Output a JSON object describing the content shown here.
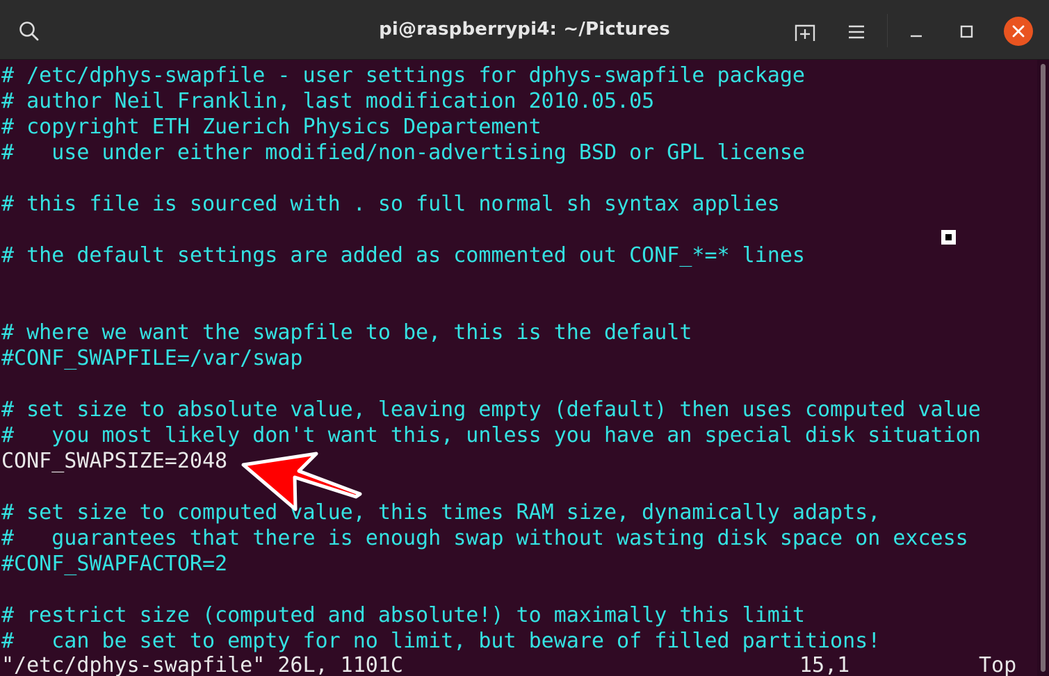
{
  "window": {
    "title": "pi@raspberrypi4: ~/Pictures",
    "icons": {
      "search": "search-icon",
      "new_tab": "new-tab-icon",
      "menu": "hamburger-menu-icon",
      "minimize": "minimize-icon",
      "maximize": "maximize-icon",
      "close": "close-icon"
    },
    "colors": {
      "terminal_bg": "#300a24",
      "comment_text": "#34e2e2",
      "plain_text": "#e8e8e8",
      "close_button": "#e95420",
      "arrow": "#ff0000"
    }
  },
  "editor": {
    "lines": [
      "# /etc/dphys-swapfile - user settings for dphys-swapfile package",
      "# author Neil Franklin, last modification 2010.05.05",
      "# copyright ETH Zuerich Physics Departement",
      "#   use under either modified/non-advertising BSD or GPL license",
      "",
      "# this file is sourced with . so full normal sh syntax applies",
      "",
      "# the default settings are added as commented out CONF_*=* lines",
      "",
      "",
      "# where we want the swapfile to be, this is the default",
      "#CONF_SWAPFILE=/var/swap",
      "",
      "# set size to absolute value, leaving empty (default) then uses computed value",
      "#   you most likely don't want this, unless you have an special disk situation",
      "CONF_SWAPSIZE=2048",
      "",
      "# set size to computed value, this times RAM size, dynamically adapts,",
      "#   guarantees that there is enough swap without wasting disk space on excess",
      "#CONF_SWAPFACTOR=2",
      "",
      "# restrict size (computed and absolute!) to maximally this limit",
      "#   can be set to empty for no limit, but beware of filled partitions!"
    ],
    "status": {
      "file": "\"/etc/dphys-swapfile\" 26L, 1101C",
      "position": "15,1",
      "scroll": "Top"
    }
  }
}
